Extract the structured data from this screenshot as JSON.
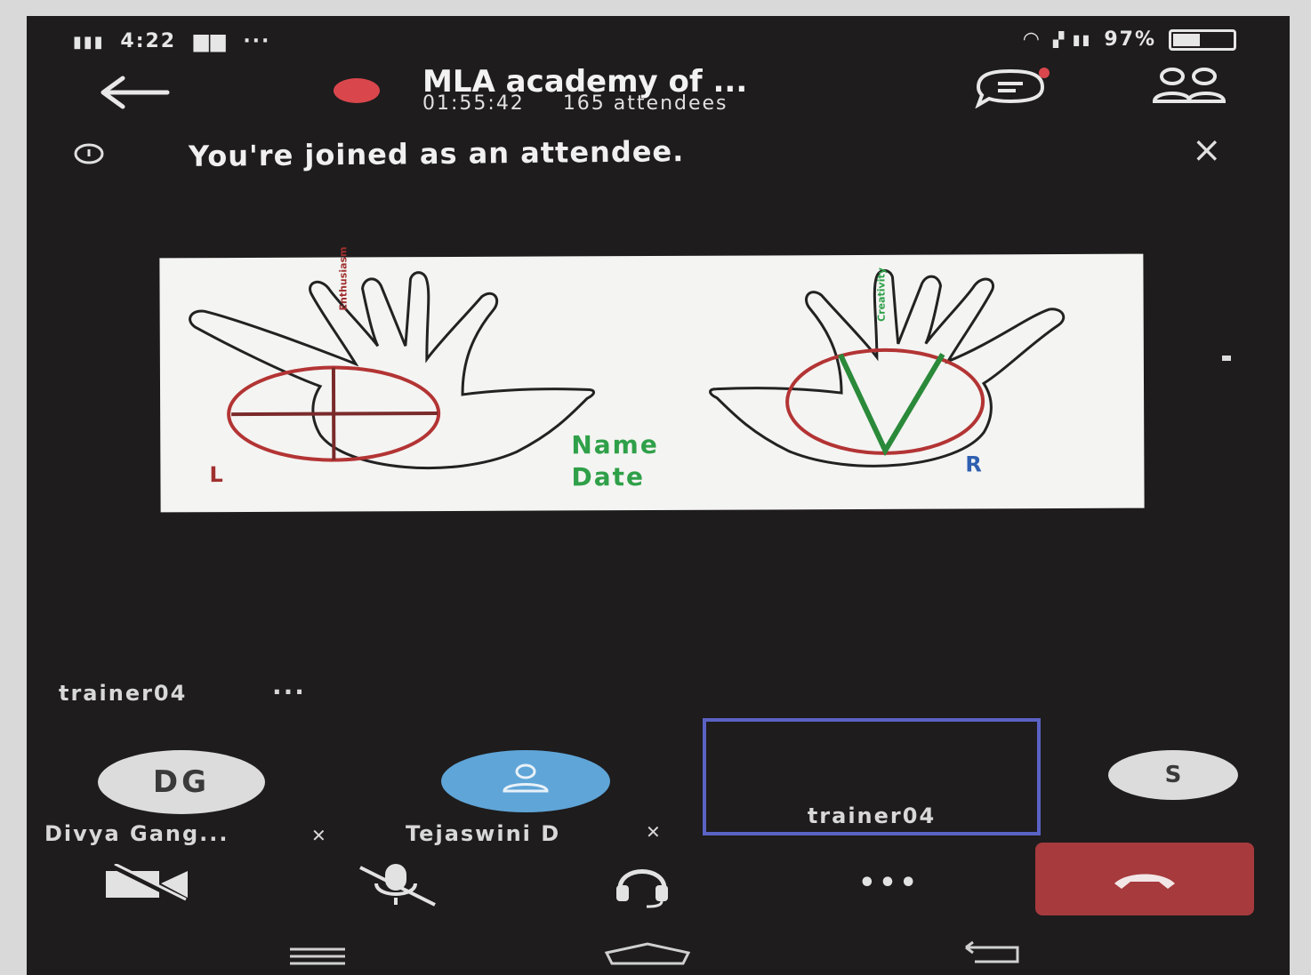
{
  "status_bar": {
    "left_text": "4:22",
    "more": "···",
    "right_text": "97%"
  },
  "header": {
    "title": "MLA academy of ...",
    "duration": "01:55:42",
    "attendees": "165 attendees"
  },
  "notice": {
    "text": "You're joined as an attendee.",
    "close": "×"
  },
  "shared_content": {
    "left_mark": "L",
    "right_mark": "R",
    "left_finger_label": "Enthusiasm",
    "right_finger_label": "Creativity",
    "name_label": "Name",
    "date_label": "Date"
  },
  "speaker": {
    "name": "trainer04",
    "more": "···"
  },
  "participants": [
    {
      "initials": "DG",
      "name": "Divya Gang..."
    },
    {
      "initials": "",
      "name": "Tejaswini D"
    },
    {
      "initials": "",
      "name": "trainer04"
    },
    {
      "initials": "S",
      "name": ""
    }
  ],
  "controls": {
    "more": "•••"
  },
  "colors": {
    "background": "#1e1c1d",
    "hangup": "#a63a3d",
    "recording_dot": "#d9474c",
    "avatar_light": "#dcdcdc",
    "avatar_blue": "#5fa5d8",
    "selected_border": "#5a63c4",
    "label_green": "#2fa049",
    "label_red": "#a03030",
    "label_blue": "#2f5fb0"
  }
}
